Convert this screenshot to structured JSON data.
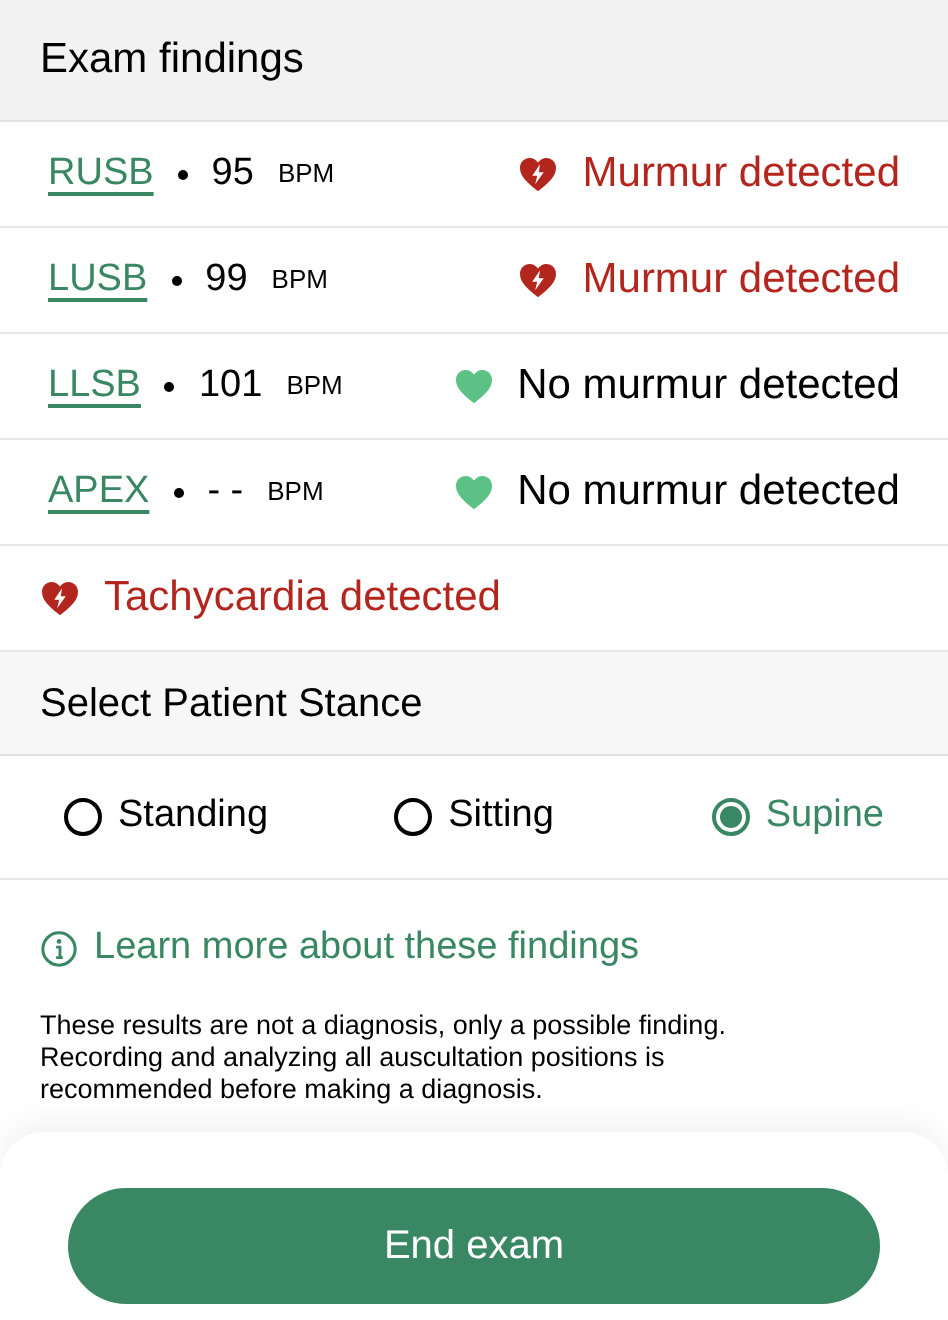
{
  "section_title": "Exam findings",
  "findings": [
    {
      "position": "RUSB",
      "bpm": "95",
      "unit": "BPM",
      "result": "Murmur detected",
      "murmur": true
    },
    {
      "position": "LUSB",
      "bpm": "99",
      "unit": "BPM",
      "result": "Murmur detected",
      "murmur": true
    },
    {
      "position": "LLSB",
      "bpm": "101",
      "unit": "BPM",
      "result": "No murmur detected",
      "murmur": false
    },
    {
      "position": "APEX",
      "bpm": "- -",
      "unit": "BPM",
      "result": "No murmur detected",
      "murmur": false
    }
  ],
  "alert": {
    "text": "Tachycardia detected",
    "detected": true
  },
  "stance": {
    "title": "Select Patient Stance",
    "options": [
      {
        "label": "Standing",
        "selected": false
      },
      {
        "label": "Sitting",
        "selected": false
      },
      {
        "label": "Supine",
        "selected": true
      }
    ]
  },
  "learn_more": "Learn more about these findings",
  "disclaimer": "These results are not a diagnosis, only a possible finding. Recording and analyzing all auscultation positions is recommended before making a diagnosis.",
  "end_button": "End exam"
}
